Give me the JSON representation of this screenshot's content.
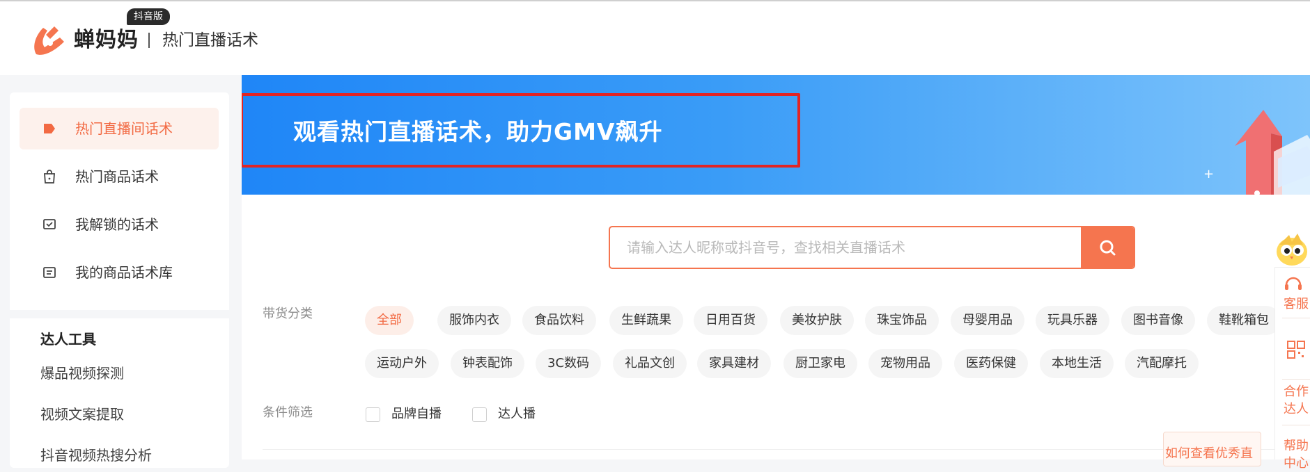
{
  "header": {
    "badge": "抖音版",
    "brand": "蝉妈妈",
    "section_title": "热门直播话术"
  },
  "sidebar": {
    "items": [
      {
        "label": "热门直播间话术",
        "icon": "tag-icon",
        "active": true
      },
      {
        "label": "热门商品话术",
        "icon": "shopping-bag-icon",
        "active": false
      },
      {
        "label": "我解锁的话术",
        "icon": "unlock-chat-icon",
        "active": false
      },
      {
        "label": "我的商品话术库",
        "icon": "document-list-icon",
        "active": false
      }
    ],
    "tools_title": "达人工具",
    "tools": [
      "爆品视频探测",
      "视频文案提取",
      "抖音视频热搜分析"
    ]
  },
  "banner": {
    "text": "观看热门直播话术，助力GMV飙升"
  },
  "search": {
    "placeholder": "请输入达人昵称或抖音号，查找相关直播话术",
    "value": ""
  },
  "filters": {
    "category_label": "带货分类",
    "categories": [
      "全部",
      "服饰内衣",
      "食品饮料",
      "生鲜蔬果",
      "日用百货",
      "美妆护肤",
      "珠宝饰品",
      "母婴用品",
      "玩具乐器",
      "图书音像",
      "鞋靴箱包",
      "运动户外",
      "钟表配饰",
      "3C数码",
      "礼品文创",
      "家具建材",
      "厨卫家电",
      "宠物用品",
      "医药保健",
      "本地生活",
      "汽配摩托"
    ],
    "active_category": "全部",
    "condition_label": "条件筛选",
    "conditions": [
      {
        "label": "品牌自播",
        "checked": false
      },
      {
        "label": "达人播",
        "checked": false
      }
    ]
  },
  "help_card": {
    "text": "如何查看优秀直"
  },
  "floating_panel": {
    "items": [
      "客服",
      "合作",
      "达人",
      "帮助",
      "中心"
    ]
  },
  "colors": {
    "accent": "#f5754f",
    "active_text": "#f26a43",
    "banner_start": "#1f86f7",
    "banner_end": "#7ec4fb",
    "highlight_box": "#e22424"
  }
}
